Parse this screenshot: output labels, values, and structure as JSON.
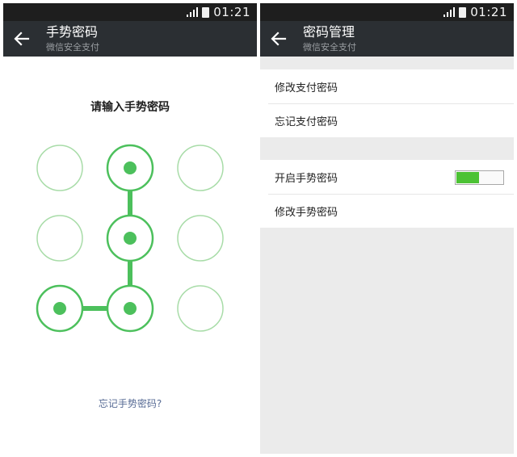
{
  "status": {
    "time": "01:21"
  },
  "left_screen": {
    "title": "手势密码",
    "subtitle": "微信安全支付",
    "prompt": "请输入手势密码",
    "forgot_link": "忘记手势密码?"
  },
  "right_screen": {
    "title": "密码管理",
    "subtitle": "微信安全支付",
    "items": [
      {
        "label": "修改支付密码"
      },
      {
        "label": "忘记支付密码"
      },
      {
        "label": "开启手势密码",
        "toggle_on": true
      },
      {
        "label": "修改手势密码"
      }
    ]
  },
  "pattern": {
    "selected": [
      1,
      4,
      7,
      6
    ],
    "active_color": "#4cc05c",
    "inactive_color": "#a8dca8"
  },
  "colors": {
    "accent_green": "#4cc234",
    "appbar": "#2b2f33",
    "link": "#576b95"
  }
}
